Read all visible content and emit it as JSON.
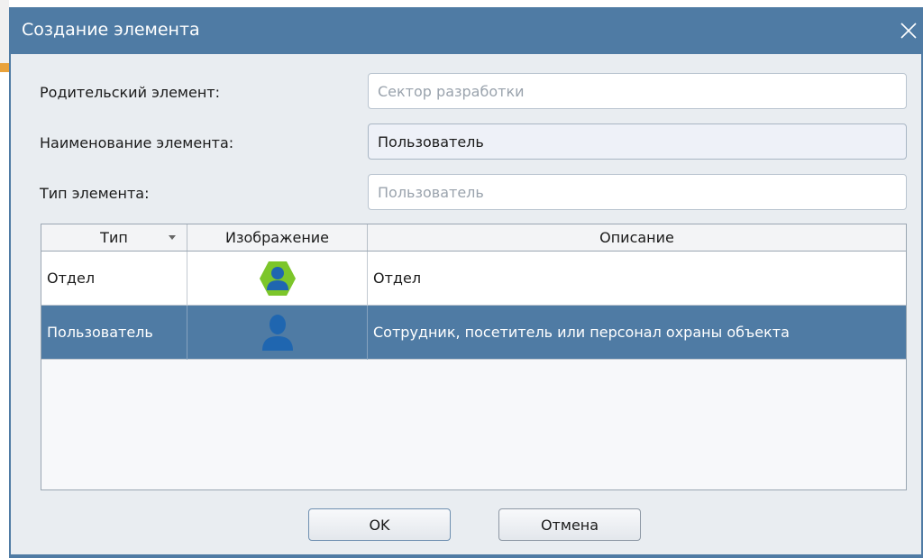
{
  "dialog": {
    "title": "Создание элемента"
  },
  "form": {
    "parent_label": "Родительский элемент:",
    "parent_placeholder": "Сектор разработки",
    "name_label": "Наименование элемента:",
    "name_value": "Пользователь",
    "type_label": "Тип элемента:",
    "type_placeholder": "Пользователь"
  },
  "grid": {
    "columns": [
      "Тип",
      "Изображение",
      "Описание"
    ],
    "rows": [
      {
        "type": "Отдел",
        "image": "department-icon",
        "description": "Отдел",
        "selected": false
      },
      {
        "type": "Пользователь",
        "image": "user-icon",
        "description": "Сотрудник, посетитель или персонал охраны объекта",
        "selected": true
      }
    ]
  },
  "buttons": {
    "ok": "OK",
    "cancel": "Отмена"
  },
  "colors": {
    "titlebar": "#4f7ba4",
    "selection": "#4f7ba4",
    "user_icon": "#1f66b0",
    "department_hex": "#7cc62a"
  }
}
